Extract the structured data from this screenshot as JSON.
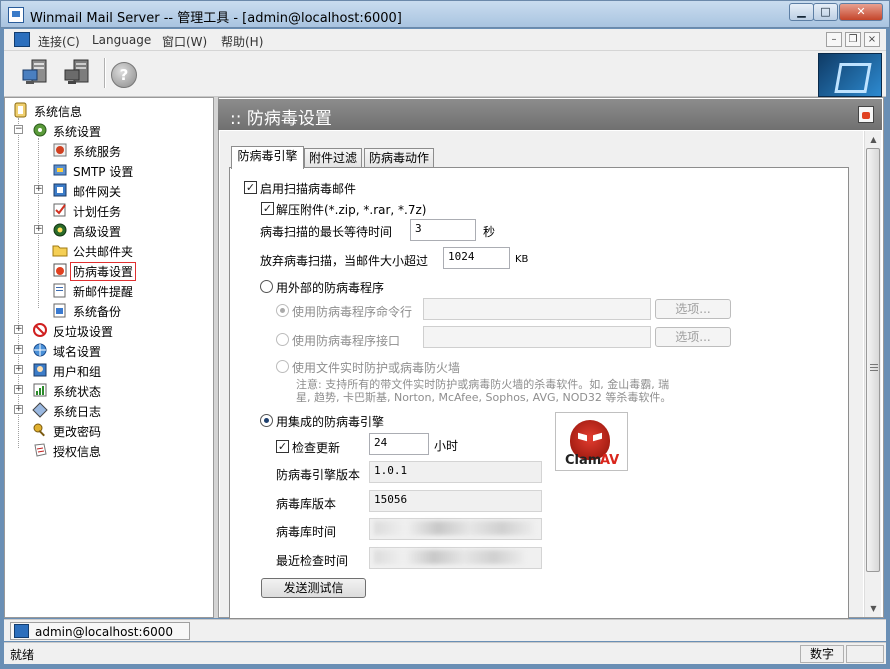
{
  "window": {
    "title": "Winmail Mail Server -- 管理工具 - [admin@localhost:6000]",
    "minimize": "▁",
    "maximize": "□",
    "close": "✕"
  },
  "menubar": {
    "items": [
      "连接(C)",
      "Language",
      "窗口(W)",
      "帮助(H)"
    ],
    "mdi_minimize": "–",
    "mdi_restore": "❐",
    "mdi_close": "×"
  },
  "toolbar": {
    "help": "?"
  },
  "tree": {
    "items": [
      {
        "label": "系统信息",
        "icon": "info-icon"
      },
      {
        "label": "系统设置",
        "icon": "gear-icon"
      },
      {
        "label": "系统服务",
        "icon": "service-icon"
      },
      {
        "label": "SMTP 设置",
        "icon": "smtp-icon"
      },
      {
        "label": "邮件网关",
        "icon": "gateway-icon"
      },
      {
        "label": "计划任务",
        "icon": "task-icon"
      },
      {
        "label": "高级设置",
        "icon": "advanced-icon"
      },
      {
        "label": "公共邮件夹",
        "icon": "folder-icon"
      },
      {
        "label": "防病毒设置",
        "icon": "antivirus-icon"
      },
      {
        "label": "新邮件提醒",
        "icon": "new-mail-icon"
      },
      {
        "label": "系统备份",
        "icon": "backup-icon"
      },
      {
        "label": "反垃圾设置",
        "icon": "antispam-icon"
      },
      {
        "label": "域名设置",
        "icon": "domain-icon"
      },
      {
        "label": "用户和组",
        "icon": "users-icon"
      },
      {
        "label": "系统状态",
        "icon": "status-icon"
      },
      {
        "label": "系统日志",
        "icon": "log-icon"
      },
      {
        "label": "更改密码",
        "icon": "password-icon"
      },
      {
        "label": "授权信息",
        "icon": "license-icon"
      }
    ]
  },
  "page": {
    "title": ":: 防病毒设置"
  },
  "tabs": [
    "防病毒引擎",
    "附件过滤",
    "防病毒动作"
  ],
  "form": {
    "enable_scan": "启用扫描病毒邮件",
    "unzip": "解压附件(*.zip, *.rar, *.7z)",
    "max_wait_label": "病毒扫描的最长等待时间",
    "max_wait_value": "3",
    "max_wait_unit": "秒",
    "skip_label": "放弃病毒扫描，当邮件大小超过",
    "skip_value": "1024",
    "skip_unit": "KB",
    "external": "用外部的防病毒程序",
    "cmdline": "使用防病毒程序命令行",
    "interface": "使用防病毒程序接口",
    "browse1": "选项...",
    "browse2": "选项...",
    "realtime": "使用文件实时防护或病毒防火墙",
    "note1": "注意: 支持所有的带文件实时防护或病毒防火墙的杀毒软件。如, 金山毒霸, 瑞",
    "note2": "星, 趋势, 卡巴斯基, Norton, McAfee, Sophos, AVG, NOD32 等杀毒软件。",
    "integrated": "用集成的防病毒引擎",
    "check_update": "检查更新",
    "check_value": "24",
    "check_unit": "小时",
    "engine_version_label": "防病毒引擎版本",
    "engine_version_value": "1.0.1",
    "db_version_label": "病毒库版本",
    "db_version_value": "15056",
    "db_time_label": "病毒库时间",
    "last_check_label": "最近检查时间",
    "send_test": "发送测试信"
  },
  "logo": {
    "text_a": "Clam",
    "text_b": "AV"
  },
  "status": {
    "connection": "admin@localhost:6000",
    "ready": "就绪",
    "num": "数字"
  }
}
